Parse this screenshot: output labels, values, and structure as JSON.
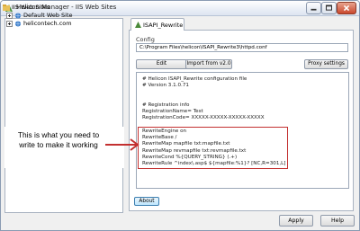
{
  "window": {
    "title": "Helicon Manager - IIS Web Sites"
  },
  "tree": {
    "root": "IIS Web Sites",
    "children": [
      "Default Web Site",
      "helicontech.com"
    ]
  },
  "tab": {
    "label": "ISAPI_Rewrite"
  },
  "config": {
    "label": "Config",
    "path": "C:\\Program Files\\helicon\\ISAPI_Rewrite3\\httpd.conf"
  },
  "buttons": {
    "edit": "Edit",
    "import": "Import from v2.0",
    "proxy": "Proxy settings",
    "about": "About",
    "apply": "Apply",
    "help": "Help"
  },
  "code": [
    "# Helicon ISAPI_Rewrite configuration file",
    "# Version 3.1.0.71",
    "",
    "# Registration info",
    "RegistrationName= Test",
    "RegistrationCode= XXXXX-XXXXX-XXXXX-XXXXX",
    "",
    "RewriteEngine on",
    "RewriteBase /",
    "RewriteMap mapfile txt:mapfile.txt",
    "RewriteMap revmapfile txt:revmapfile.txt",
    "RewriteCond %{QUERY_STRING} (.+)",
    "RewriteRule ^index\\.asp$ ${mapfile:%1}? [NC,R=301,L]"
  ],
  "annotation": "This is what you need to write to make it working",
  "colors": {
    "highlight": "#c33030",
    "tree_icon": "#3a7ccb"
  }
}
